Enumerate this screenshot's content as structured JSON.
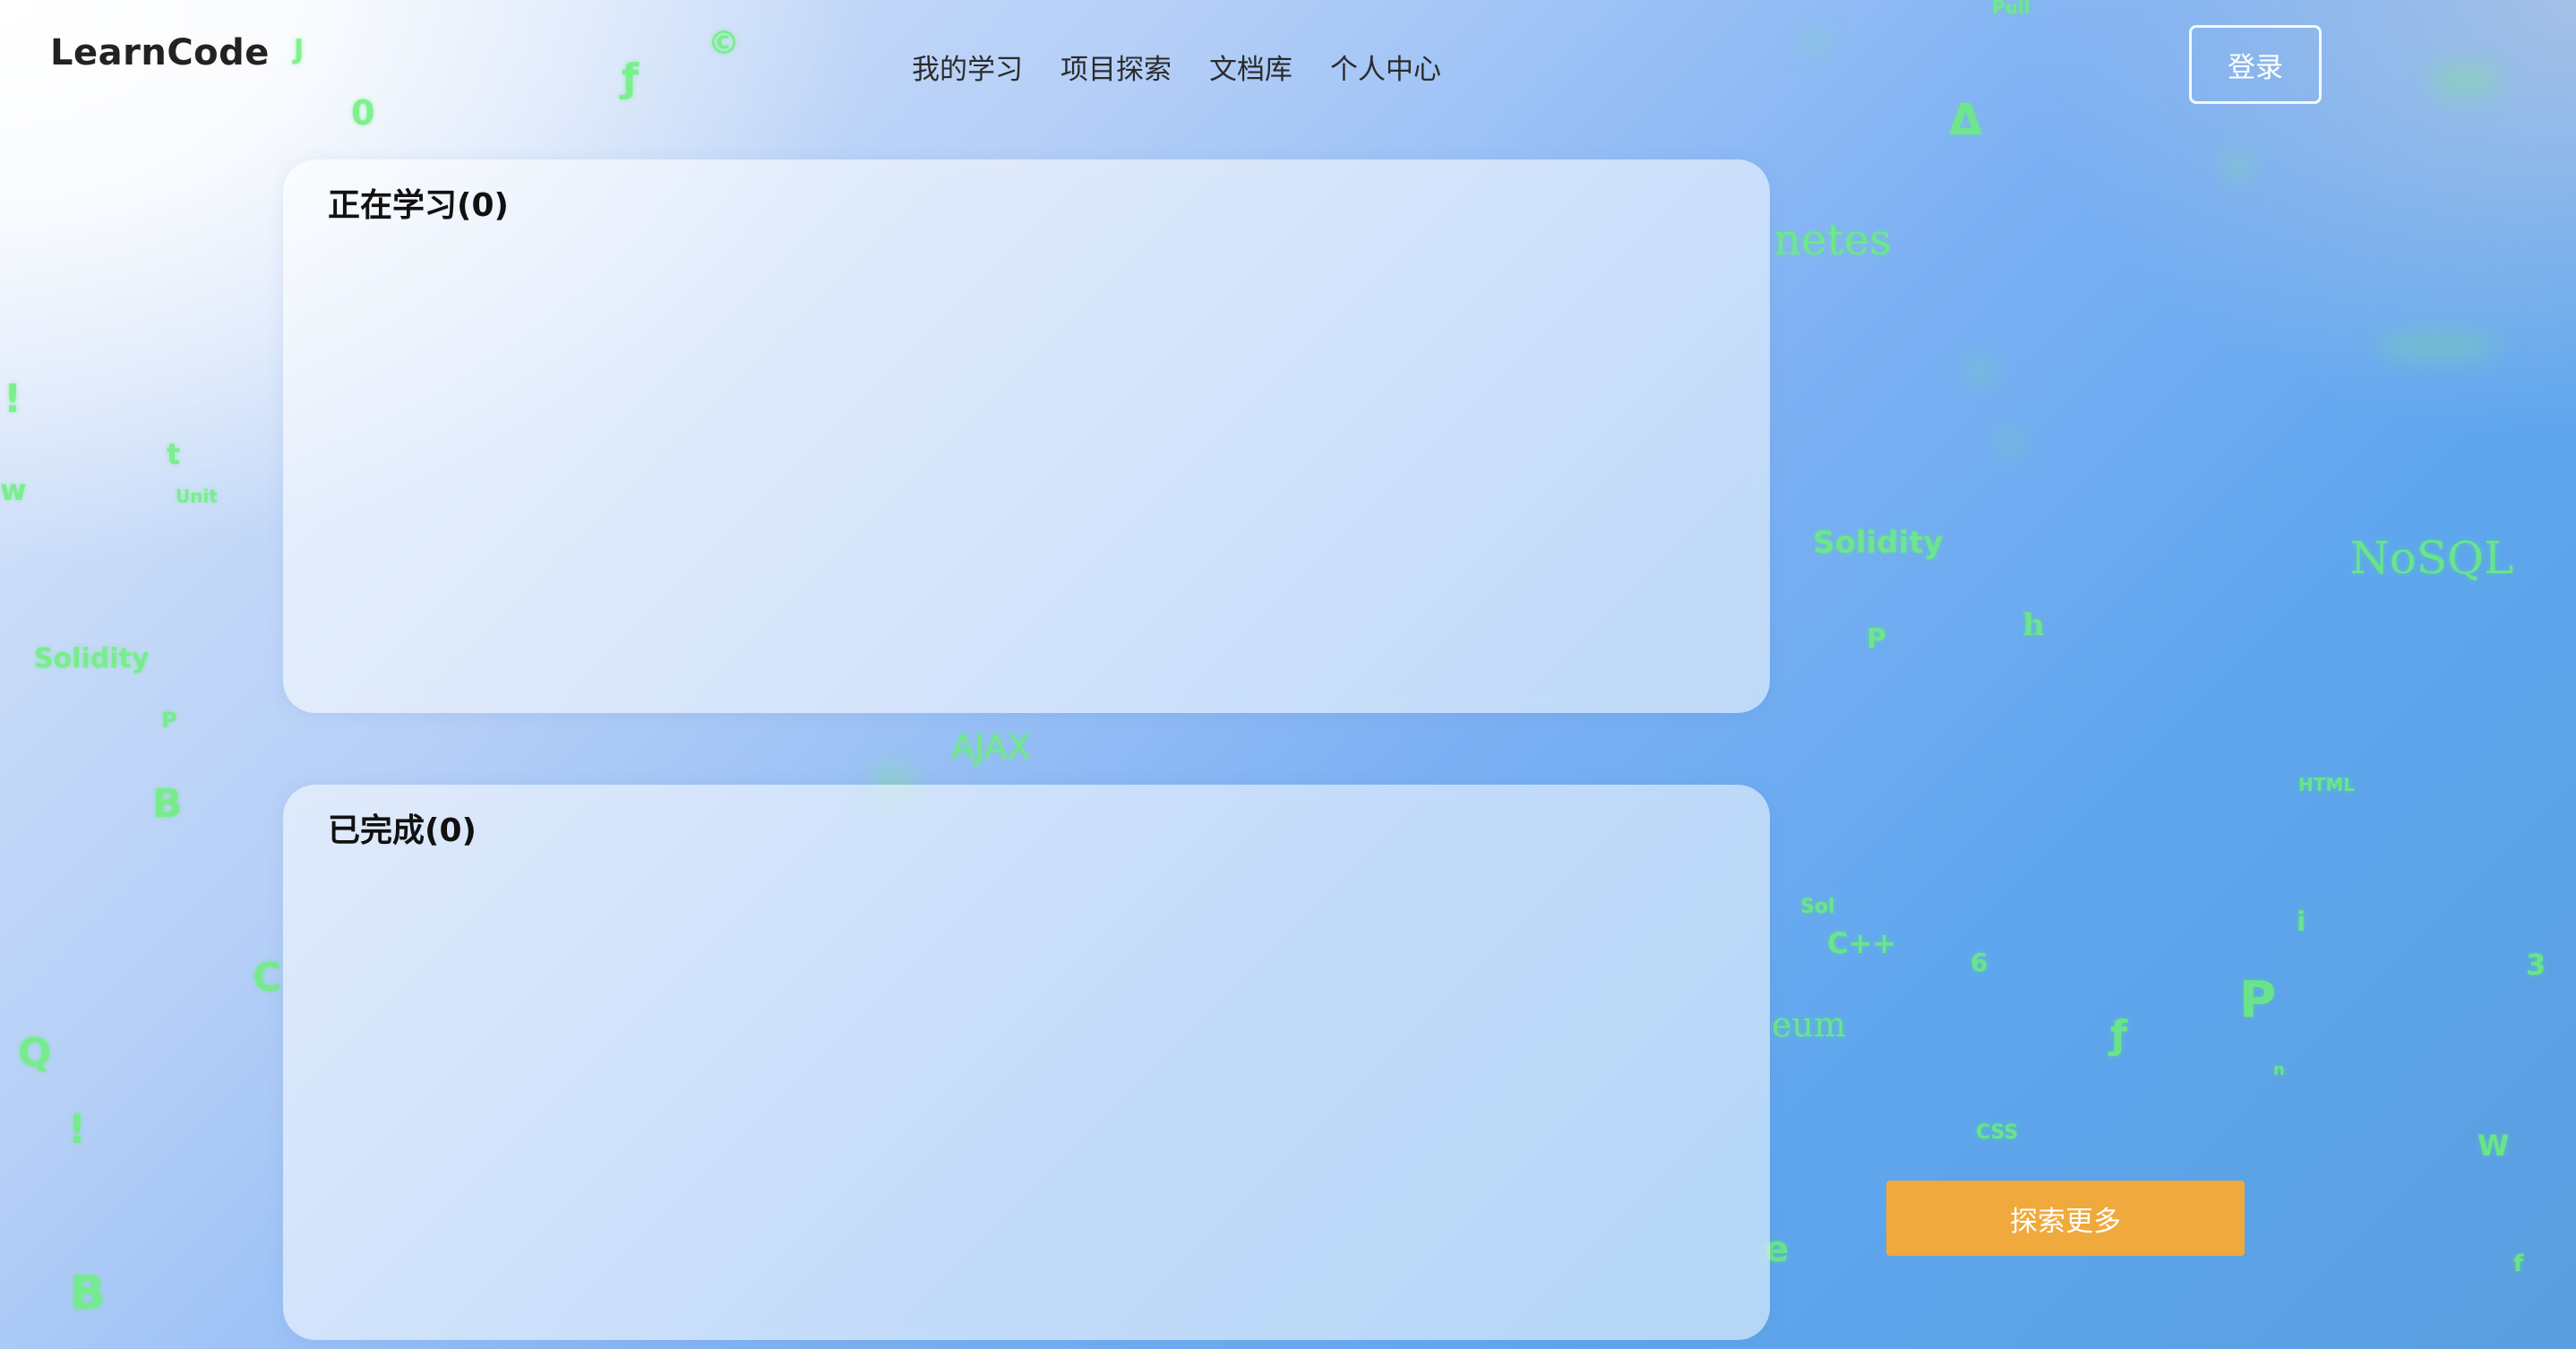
{
  "header": {
    "brand": "LearnCode",
    "nav": [
      "我的学习",
      "项目探索",
      "文档库",
      "个人中心"
    ],
    "login_label": "登录"
  },
  "panels": {
    "learning_title": "正在学习(0)",
    "completed_title": "已完成(0)"
  },
  "actions": {
    "explore_more_label": "探索更多"
  },
  "background_glyphs": [
    "J",
    "0",
    "ƒ",
    "©",
    "Pull",
    "Δ",
    "NoSQL",
    "Solidity",
    "AJAX",
    "C++",
    "eum",
    "netes",
    "HTML",
    "CSS",
    "Sol",
    "Unit",
    "t",
    "w",
    "!",
    "Solidity",
    "P",
    "B",
    "C",
    "Q",
    "!",
    "B",
    "P",
    "h",
    "6",
    "ƒ",
    "P",
    "i",
    "3",
    "W",
    "f",
    "n",
    "e"
  ],
  "colors": {
    "accent": "#f0a93c",
    "glyph": "#6cf07c"
  }
}
